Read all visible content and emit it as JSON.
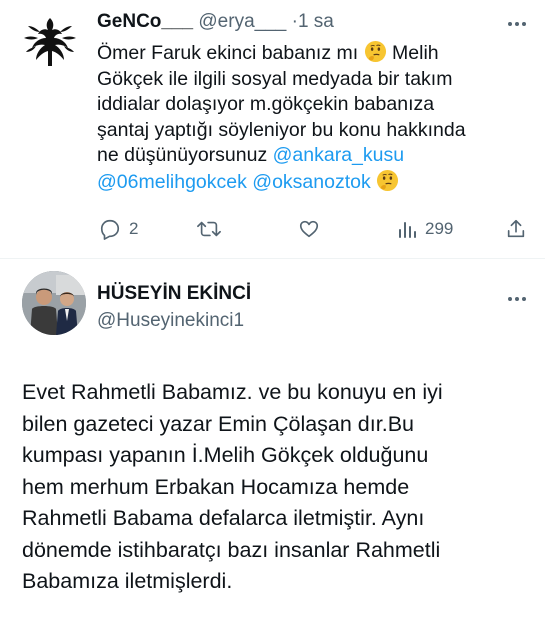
{
  "reply_tweet": {
    "author_name": "GeNCo___",
    "author_handle": "@erya___",
    "separator": "·",
    "time": "1 sa",
    "text_lines": [
      {
        "text": "Ömer Faruk ekinci babanız mı",
        "has_emoji_after": true,
        "tail": "Melih"
      },
      {
        "text": "Gökçek ile ilgili sosyal medyada bir takım"
      },
      {
        "text": "iddialar dolaşıyor m.gökçekin babanıza"
      },
      {
        "text": "şantaj yaptığı söyleniyor bu konu hakkında"
      },
      {
        "text": "ne düşünüyorsunuz",
        "mention": "@ankara_kusu"
      },
      {
        "mentions": [
          "@06melihgokcek",
          "@oksanoztok"
        ],
        "has_emoji_after": true
      }
    ],
    "emoji_name": "thinking-face",
    "actions": {
      "reply_count": "2",
      "retweet_count": "",
      "like_count": "",
      "view_count": "299"
    }
  },
  "main_tweet": {
    "author_name": "HÜSEYİN EKİNCİ",
    "author_handle": "@Huseyinekinci1",
    "text_lines": [
      "Evet Rahmetli Babamız. ve bu konuyu en iyi",
      "bilen  gazeteci yazar Emin Çölaşan dır.Bu",
      "kumpası yapanın İ.Melih Gökçek olduğunu",
      "hem merhum Erbakan Hocamıza hemde",
      "Rahmetli Babama defalarca iletmiştir. Aynı",
      "dönemde istihbaratçı bazı insanlar Rahmetli",
      "Babamıza iletmişlerdi."
    ]
  },
  "colors": {
    "text": "#0f1419",
    "secondary": "#536471",
    "link": "#1d9bf0",
    "divider": "#eff3f4"
  },
  "icons": [
    "more-icon",
    "reply-icon",
    "retweet-icon",
    "like-icon",
    "views-icon",
    "share-icon",
    "thinking-face-emoji"
  ]
}
